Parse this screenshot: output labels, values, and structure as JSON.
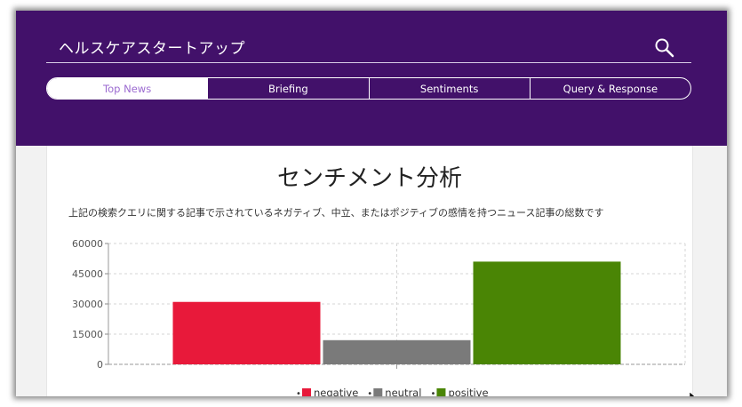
{
  "app": {
    "title": "ヘルスケアスタートアップ",
    "icons": {
      "search": "search-icon"
    }
  },
  "tabs": [
    {
      "label": "Top News",
      "active": true
    },
    {
      "label": "Briefing",
      "active": false
    },
    {
      "label": "Sentiments",
      "active": false
    },
    {
      "label": "Query & Response",
      "active": false
    }
  ],
  "section": {
    "title": "センチメント分析",
    "description": "上記の検索クエリに関する記事で示されているネガティブ、中立、またはポジティブの感情を持つニュース記事の総数です"
  },
  "colors": {
    "header_bg": "#42116a",
    "active_tab_text": "#9b6ad0"
  },
  "chart_data": {
    "type": "bar",
    "categories": [
      "negative",
      "neutral",
      "positive"
    ],
    "series": [
      {
        "name": "negative",
        "value": 31000,
        "color": "#e8193a"
      },
      {
        "name": "neutral",
        "value": 12000,
        "color": "#7a7a7a"
      },
      {
        "name": "positive",
        "value": 51000,
        "color": "#4a8505"
      }
    ],
    "ylim": [
      0,
      60000
    ],
    "yticks": [
      "0",
      "15000",
      "30000",
      "45000",
      "60000"
    ],
    "grid": true,
    "legend": "bottom"
  }
}
